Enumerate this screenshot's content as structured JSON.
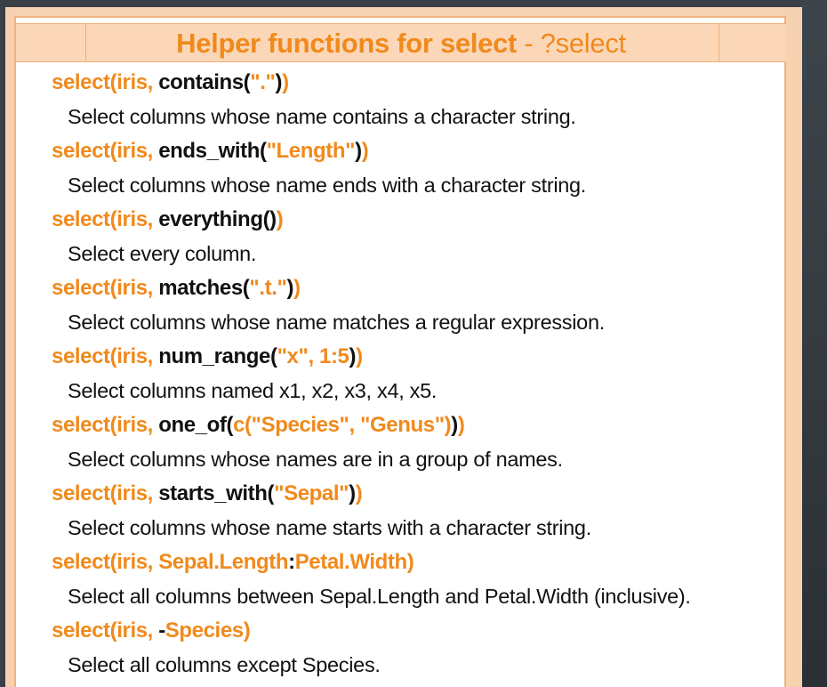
{
  "title": {
    "main": "Helper functions for select",
    "sub": " - ?select"
  },
  "colors": {
    "accent": "#f08a1c",
    "band": "#fbd7b8",
    "text": "#111111"
  },
  "entries": [
    {
      "parts": [
        {
          "t": "select(iris, ",
          "c": "o"
        },
        {
          "t": "contains(",
          "c": "k"
        },
        {
          "t": "\".\"",
          "c": "o"
        },
        {
          "t": ")",
          "c": "k"
        },
        {
          "t": ")",
          "c": "o"
        }
      ],
      "desc": "Select columns whose name contains a character string."
    },
    {
      "parts": [
        {
          "t": "select(iris, ",
          "c": "o"
        },
        {
          "t": "ends_with(",
          "c": "k"
        },
        {
          "t": "\"Length\"",
          "c": "o"
        },
        {
          "t": ")",
          "c": "k"
        },
        {
          "t": ")",
          "c": "o"
        }
      ],
      "desc": "Select columns whose name ends with a character string."
    },
    {
      "parts": [
        {
          "t": "select(iris, ",
          "c": "o"
        },
        {
          "t": "everything()",
          "c": "k"
        },
        {
          "t": ")",
          "c": "o"
        }
      ],
      "desc": "Select every column."
    },
    {
      "parts": [
        {
          "t": "select(iris, ",
          "c": "o"
        },
        {
          "t": "matches(",
          "c": "k"
        },
        {
          "t": "\".t.\"",
          "c": "o"
        },
        {
          "t": ")",
          "c": "k"
        },
        {
          "t": ")",
          "c": "o"
        }
      ],
      "desc": "Select columns whose name matches a regular expression."
    },
    {
      "parts": [
        {
          "t": "select(iris, ",
          "c": "o"
        },
        {
          "t": "num_range(",
          "c": "k"
        },
        {
          "t": "\"x\", 1:5",
          "c": "o"
        },
        {
          "t": ")",
          "c": "k"
        },
        {
          "t": ")",
          "c": "o"
        }
      ],
      "desc": "Select columns named x1, x2, x3, x4, x5."
    },
    {
      "parts": [
        {
          "t": "select(iris, ",
          "c": "o"
        },
        {
          "t": "one_of(",
          "c": "k"
        },
        {
          "t": "c(\"Species\", \"Genus\")",
          "c": "o"
        },
        {
          "t": ")",
          "c": "k"
        },
        {
          "t": ")",
          "c": "o"
        }
      ],
      "desc": "Select columns whose names are in a group of names."
    },
    {
      "parts": [
        {
          "t": "select(iris, ",
          "c": "o"
        },
        {
          "t": "starts_with(",
          "c": "k"
        },
        {
          "t": "\"Sepal\"",
          "c": "o"
        },
        {
          "t": ")",
          "c": "k"
        },
        {
          "t": ")",
          "c": "o"
        }
      ],
      "desc": "Select columns whose name starts with a character string."
    },
    {
      "parts": [
        {
          "t": "select(iris, ",
          "c": "o"
        },
        {
          "t": "Sepal.Length",
          "c": "o"
        },
        {
          "t": ":",
          "c": "k"
        },
        {
          "t": "Petal.Width",
          "c": "o"
        },
        {
          "t": ")",
          "c": "o"
        }
      ],
      "desc": "Select all columns between Sepal.Length and Petal.Width (inclusive)."
    },
    {
      "parts": [
        {
          "t": "select(iris, ",
          "c": "o"
        },
        {
          "t": "-",
          "c": "k"
        },
        {
          "t": "Species",
          "c": "o"
        },
        {
          "t": ")",
          "c": "o"
        }
      ],
      "desc": "Select all columns except Species."
    }
  ]
}
